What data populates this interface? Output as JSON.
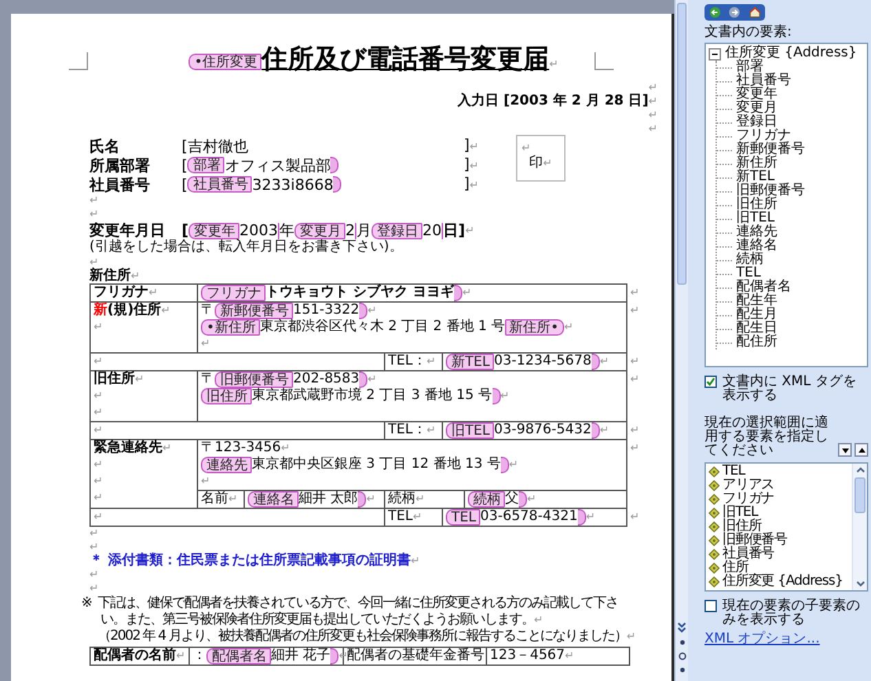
{
  "document": [
    {
      "kind": "title",
      "parts": [
        {
          "kind": "open",
          "text": "•住所変更"
        },
        {
          "kind": "text",
          "text": "住所及び電話番号変更届",
          "bold": true
        },
        {
          "kind": "mark",
          "text": "↵"
        }
      ]
    },
    {
      "kind": "right",
      "parts": [
        {
          "kind": "mark",
          "text": "↵"
        }
      ]
    },
    {
      "kind": "right",
      "parts": [
        {
          "kind": "text",
          "text": "入力日 [2003 年 2 月 28 日]",
          "bold": true
        },
        {
          "kind": "mark",
          "text": "↵"
        }
      ]
    },
    {
      "kind": "right",
      "parts": [
        {
          "kind": "mark",
          "text": "↵"
        }
      ]
    },
    {
      "kind": "right",
      "parts": [
        {
          "kind": "mark",
          "text": "↵"
        }
      ]
    },
    {
      "kind": "fields",
      "rows": [
        {
          "label": "氏名",
          "parts": [
            {
              "kind": "text",
              "text": "[吉村徹也"
            }
          ],
          "end": [
            {
              "kind": "text",
              "text": "]"
            },
            {
              "kind": "mark",
              "text": "↵"
            }
          ]
        },
        {
          "label": "所属部署",
          "parts": [
            {
              "kind": "text",
              "text": "["
            },
            {
              "kind": "open",
              "text": "部署"
            },
            {
              "kind": "text",
              "text": "オフィス製品部"
            },
            {
              "kind": "close"
            }
          ],
          "end": [
            {
              "kind": "text",
              "text": "]"
            },
            {
              "kind": "mark",
              "text": "↵"
            }
          ]
        },
        {
          "label": "社員番号",
          "parts": [
            {
              "kind": "text",
              "text": "["
            },
            {
              "kind": "open",
              "text": "社員番号"
            },
            {
              "kind": "text",
              "text": "3233i8668"
            },
            {
              "kind": "close"
            }
          ],
          "end": [
            {
              "kind": "text",
              "text": "]"
            },
            {
              "kind": "mark",
              "text": "↵"
            }
          ]
        }
      ],
      "stamp": [
        [
          {
            "kind": "mark",
            "text": "↵"
          }
        ],
        [
          {
            "kind": "text",
            "text": "印"
          },
          {
            "kind": "mark",
            "text": "↵"
          }
        ]
      ]
    },
    {
      "kind": "para",
      "parts": [
        {
          "kind": "mark",
          "text": "↵"
        }
      ]
    },
    {
      "kind": "para",
      "parts": [
        {
          "kind": "mark",
          "text": "↵"
        }
      ]
    },
    {
      "kind": "fields",
      "rows": [
        {
          "label": "変更年月日",
          "parts": [
            {
              "kind": "text",
              "text": "[",
              "bold": true
            },
            {
              "kind": "open",
              "text": "変更年"
            },
            {
              "kind": "text",
              "text": "2003"
            },
            {
              "kind": "close"
            },
            {
              "kind": "text",
              "text": "年"
            },
            {
              "kind": "open",
              "text": "変更月"
            },
            {
              "kind": "text",
              "text": "2"
            },
            {
              "kind": "close"
            },
            {
              "kind": "text",
              "text": "月"
            },
            {
              "kind": "open",
              "text": "登録日"
            },
            {
              "kind": "text",
              "text": "20"
            },
            {
              "kind": "close"
            },
            {
              "kind": "text",
              "text": "日]",
              "bold": true
            },
            {
              "kind": "mark",
              "text": "↵"
            }
          ]
        }
      ]
    },
    {
      "kind": "small",
      "parts": [
        {
          "kind": "text",
          "text": "(引越をした場合は、転入年月日をお書き下さい)。"
        }
      ]
    },
    {
      "kind": "para",
      "parts": [
        {
          "kind": "mark",
          "text": "↵"
        }
      ]
    },
    {
      "kind": "para",
      "parts": [
        {
          "kind": "text",
          "text": "新住所",
          "bold": true
        },
        {
          "kind": "mark",
          "text": "↵"
        }
      ]
    },
    {
      "kind": "table",
      "rows": [
        {
          "cells": [
            {
              "lines": [
                [
                  {
                    "kind": "text",
                    "text": "フリガナ",
                    "bold": true
                  },
                  {
                    "kind": "mark",
                    "text": "↵"
                  }
                ]
              ]
            },
            {
              "colspan": 5,
              "lines": [
                [
                  {
                    "kind": "open",
                    "text": "フリガナ"
                  },
                  {
                    "kind": "text",
                    "text": "トウキョウト シブヤク ヨヨギ",
                    "bold": true
                  },
                  {
                    "kind": "close"
                  },
                  {
                    "kind": "mark",
                    "text": "↵"
                  }
                ]
              ]
            }
          ],
          "after": "↵"
        },
        {
          "cells": [
            {
              "lines": [
                [
                  {
                    "kind": "text",
                    "text": "新",
                    "bold": true,
                    "color": "#ff0000"
                  },
                  {
                    "kind": "text",
                    "text": "(規)住所",
                    "bold": true
                  },
                  {
                    "kind": "mark",
                    "text": "↵"
                  }
                ],
                [
                  {
                    "kind": "mark",
                    "text": "↵"
                  }
                ]
              ]
            },
            {
              "colspan": 5,
              "lines": [
                [
                  {
                    "kind": "text",
                    "text": "〒"
                  },
                  {
                    "kind": "open",
                    "text": "新郵便番号"
                  },
                  {
                    "kind": "text",
                    "text": "151-3322"
                  },
                  {
                    "kind": "close"
                  },
                  {
                    "kind": "mark",
                    "text": "↵"
                  }
                ],
                [
                  {
                    "kind": "open",
                    "text": "•新住所"
                  },
                  {
                    "kind": "text",
                    "text": "東京都渋谷区代々木 2 丁目 2 番地 1 号"
                  },
                  {
                    "kind": "end",
                    "text": "新住所•"
                  },
                  {
                    "kind": "mark",
                    "text": "↵"
                  }
                ],
                [
                  {
                    "kind": "mark",
                    "text": "↵"
                  }
                ]
              ]
            }
          ],
          "after": "↵"
        },
        {
          "cells": [
            {
              "colspan": 3,
              "lines": [
                [
                  {
                    "kind": "mark",
                    "text": "↵"
                  }
                ]
              ]
            },
            {
              "lines": [
                [
                  {
                    "kind": "text",
                    "text": "TEL："
                  },
                  {
                    "kind": "mark",
                    "text": "↵"
                  }
                ]
              ]
            },
            {
              "colspan": 2,
              "lines": [
                [
                  {
                    "kind": "open",
                    "text": "新TEL"
                  },
                  {
                    "kind": "text",
                    "text": "03-1234-5678"
                  },
                  {
                    "kind": "close"
                  },
                  {
                    "kind": "mark",
                    "text": "↵"
                  }
                ]
              ]
            }
          ],
          "after": "↵"
        },
        {
          "cells": [
            {
              "lines": [
                [
                  {
                    "kind": "text",
                    "text": "旧住所",
                    "bold": true
                  },
                  {
                    "kind": "mark",
                    "text": "↵"
                  }
                ],
                [
                  {
                    "kind": "mark",
                    "text": "↵"
                  }
                ],
                [
                  {
                    "kind": "mark",
                    "text": "↵"
                  }
                ]
              ]
            },
            {
              "colspan": 5,
              "lines": [
                [
                  {
                    "kind": "text",
                    "text": "〒"
                  },
                  {
                    "kind": "open",
                    "text": "旧郵便番号"
                  },
                  {
                    "kind": "text",
                    "text": "202-8583"
                  },
                  {
                    "kind": "close"
                  },
                  {
                    "kind": "mark",
                    "text": "↵"
                  }
                ],
                [
                  {
                    "kind": "open",
                    "text": "旧住所"
                  },
                  {
                    "kind": "text",
                    "text": "東京都武蔵野市境 2 丁目 3 番地 15 号"
                  },
                  {
                    "kind": "close"
                  },
                  {
                    "kind": "mark",
                    "text": "↵"
                  }
                ]
              ]
            }
          ],
          "after": "↵"
        },
        {
          "cells": [
            {
              "colspan": 3,
              "lines": [
                [
                  {
                    "kind": "mark",
                    "text": "↵"
                  }
                ]
              ]
            },
            {
              "lines": [
                [
                  {
                    "kind": "text",
                    "text": "TEL："
                  },
                  {
                    "kind": "mark",
                    "text": "↵"
                  }
                ]
              ]
            },
            {
              "colspan": 2,
              "lines": [
                [
                  {
                    "kind": "open",
                    "text": "旧TEL"
                  },
                  {
                    "kind": "text",
                    "text": "03-9876-5432"
                  },
                  {
                    "kind": "close"
                  },
                  {
                    "kind": "mark",
                    "text": "↵"
                  }
                ]
              ]
            }
          ],
          "after": "↵"
        },
        {
          "cells": [
            {
              "rowspan": 2,
              "lines": [
                [
                  {
                    "kind": "text",
                    "text": "緊急連絡先",
                    "bold": true
                  },
                  {
                    "kind": "mark",
                    "text": "↵"
                  }
                ],
                [
                  {
                    "kind": "mark",
                    "text": "↵"
                  }
                ],
                [
                  {
                    "kind": "mark",
                    "text": "↵"
                  }
                ],
                [
                  {
                    "kind": "mark",
                    "text": "↵"
                  }
                ]
              ]
            },
            {
              "colspan": 5,
              "lines": [
                [
                  {
                    "kind": "text",
                    "text": "〒123-3456"
                  },
                  {
                    "kind": "mark",
                    "text": "↵"
                  }
                ],
                [
                  {
                    "kind": "open",
                    "text": "連絡先"
                  },
                  {
                    "kind": "text",
                    "text": "東京都中央区銀座 3 丁目 12 番地 13 号"
                  },
                  {
                    "kind": "close"
                  },
                  {
                    "kind": "mark",
                    "text": "↵"
                  }
                ],
                [
                  {
                    "kind": "mark",
                    "text": "↵"
                  }
                ]
              ]
            }
          ],
          "after": "↵"
        },
        {
          "cells": [
            {
              "lines": [
                [
                  {
                    "kind": "text",
                    "text": "名前"
                  },
                  {
                    "kind": "mark",
                    "text": "↵"
                  }
                ]
              ]
            },
            {
              "lines": [
                [
                  {
                    "kind": "open",
                    "text": "連絡名"
                  },
                  {
                    "kind": "text",
                    "text": "細井 太郎"
                  },
                  {
                    "kind": "close"
                  },
                  {
                    "kind": "mark",
                    "text": "↵"
                  }
                ]
              ]
            },
            {
              "colspan": 2,
              "lines": [
                [
                  {
                    "kind": "text",
                    "text": "続柄"
                  },
                  {
                    "kind": "mark",
                    "text": "↵"
                  }
                ]
              ]
            },
            {
              "lines": [
                [
                  {
                    "kind": "open",
                    "text": "続柄"
                  },
                  {
                    "kind": "text",
                    "text": "父"
                  },
                  {
                    "kind": "close"
                  },
                  {
                    "kind": "mark",
                    "text": "↵"
                  }
                ]
              ]
            }
          ]
        },
        {
          "cells": [
            {
              "colspan": 3,
              "lines": [
                [
                  {
                    "kind": "mark",
                    "text": "↵"
                  }
                ]
              ]
            },
            {
              "lines": [
                [
                  {
                    "kind": "text",
                    "text": "TEL"
                  },
                  {
                    "kind": "mark",
                    "text": "↵"
                  }
                ]
              ]
            },
            {
              "colspan": 2,
              "lines": [
                [
                  {
                    "kind": "open",
                    "text": "TEL"
                  },
                  {
                    "kind": "text",
                    "text": "03-6578-4321"
                  },
                  {
                    "kind": "close"
                  },
                  {
                    "kind": "mark",
                    "text": "↵"
                  }
                ]
              ]
            }
          ],
          "after": "↵"
        }
      ]
    },
    {
      "kind": "para",
      "parts": [
        {
          "kind": "mark",
          "text": "↵"
        }
      ]
    },
    {
      "kind": "para",
      "parts": [
        {
          "kind": "mark",
          "text": "↵"
        }
      ]
    },
    {
      "kind": "para",
      "parts": [
        {
          "kind": "text",
          "text": "＊ 添付書類：住民票または住所票記載事項の証明書",
          "bold": true,
          "color": "#1f1fd0"
        },
        {
          "kind": "mark",
          "text": "↵"
        }
      ]
    },
    {
      "kind": "para",
      "parts": [
        {
          "kind": "mark",
          "text": "↵"
        }
      ]
    },
    {
      "kind": "para",
      "parts": [
        {
          "kind": "mark",
          "text": "↵"
        }
      ]
    },
    {
      "kind": "note",
      "marker": "※",
      "lines": [
        [
          {
            "kind": "text",
            "text": "下記は、健保で配偶者を扶養されている方で、今回一緒に住所変更される方のみ記載して下さ"
          }
        ],
        [
          {
            "kind": "text",
            "text": "い。また、第三号被保険者住所変更届も提出していただくようお願いします。"
          },
          {
            "kind": "mark",
            "text": "↵"
          }
        ],
        [
          {
            "kind": "text",
            "text": "（2002 年 4 月より、被扶養配偶者の住所変更も社会保険事務所に報告することになりました）"
          },
          {
            "kind": "mark",
            "text": "↵"
          }
        ]
      ]
    },
    {
      "kind": "table",
      "rows": [
        {
          "cells": [
            {
              "lines": [
                [
                  {
                    "kind": "text",
                    "text": "配偶者の名前",
                    "bold": true
                  },
                  {
                    "kind": "mark",
                    "text": "↵"
                  }
                ]
              ]
            },
            {
              "lines": [
                [
                  {
                    "kind": "text",
                    "text": "："
                  },
                  {
                    "kind": "open",
                    "text": "配偶者名"
                  },
                  {
                    "kind": "text",
                    "text": "細井 花子"
                  },
                  {
                    "kind": "close"
                  },
                  {
                    "kind": "mark",
                    "text": "↵"
                  }
                ]
              ]
            },
            {
              "lines": [
                [
                  {
                    "kind": "text",
                    "text": "配偶者の基礎年金番号"
                  }
                ]
              ]
            },
            {
              "lines": [
                [
                  {
                    "kind": "text",
                    "text": "123－4567"
                  },
                  {
                    "kind": "mark",
                    "text": "↵"
                  }
                ]
              ]
            }
          ]
        }
      ]
    }
  ],
  "pane": {
    "elements_label": "文書内の要素:",
    "tree": [
      {
        "label": "住所変更 {Address}",
        "expanded": true,
        "children": [
          {
            "label": "部署"
          },
          {
            "label": "社員番号"
          },
          {
            "label": "変更年"
          },
          {
            "label": "変更月"
          },
          {
            "label": "登録日"
          },
          {
            "label": "フリガナ"
          },
          {
            "label": "新郵便番号"
          },
          {
            "label": "新住所"
          },
          {
            "label": "新TEL"
          },
          {
            "label": "旧郵便番号"
          },
          {
            "label": "旧住所"
          },
          {
            "label": "旧TEL"
          },
          {
            "label": "連絡先"
          },
          {
            "label": "連絡名"
          },
          {
            "label": "続柄"
          },
          {
            "label": "TEL"
          },
          {
            "label": "配偶者名"
          },
          {
            "label": "配生年"
          },
          {
            "label": "配生月"
          },
          {
            "label": "配生日"
          },
          {
            "label": "配住所"
          }
        ]
      }
    ],
    "show_tags": {
      "label": "文書内に XML タグを表示する",
      "checked": true
    },
    "apply_label": "現在の選択範囲に適用する要素を指定してください",
    "element_list": [
      {
        "label": "TEL"
      },
      {
        "label": "アリアス"
      },
      {
        "label": "フリガナ"
      },
      {
        "label": "旧TEL"
      },
      {
        "label": "旧住所"
      },
      {
        "label": "旧郵便番号"
      },
      {
        "label": "社員番号"
      },
      {
        "label": "住所"
      },
      {
        "label": "住所変更 {Address}"
      }
    ],
    "children_only": {
      "label": "現在の要素の子要素のみを表示する",
      "checked": false
    },
    "options_link": "XML オプション..."
  }
}
